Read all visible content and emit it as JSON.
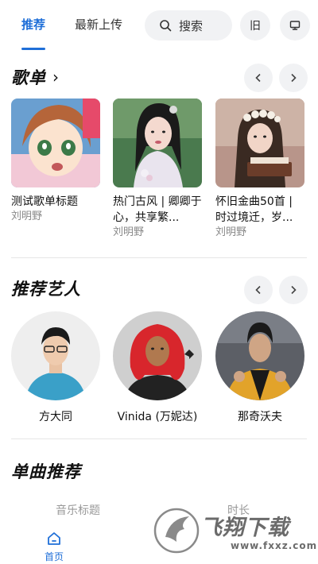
{
  "header": {
    "tabs": [
      {
        "label": "推荐",
        "active": true
      },
      {
        "label": "最新上传",
        "active": false
      }
    ],
    "search": {
      "label": "搜索",
      "icon": "search-icon"
    },
    "old_button_label": "旧",
    "desktop_icon": "monitor-icon",
    "accent_color": "#1f6fd8"
  },
  "playlists": {
    "title": "歌单",
    "title_chevron": "›",
    "items": [
      {
        "title": "测试歌单标题",
        "author": "刘明野"
      },
      {
        "title": "热门古风 | 卿卿于心，共享繁...",
        "author": "刘明野"
      },
      {
        "title": "怀旧金曲50首 | 时过境迁，岁...",
        "author": "刘明野"
      }
    ]
  },
  "artists": {
    "title": "推荐艺人",
    "items": [
      {
        "name": "方大同"
      },
      {
        "name": "Vinida (万妮达)"
      },
      {
        "name": "那奇沃夫"
      }
    ]
  },
  "songs": {
    "title": "单曲推荐",
    "columns": [
      "音乐标题",
      "时长"
    ]
  },
  "bottom_nav": {
    "home_label": "首页",
    "home_icon": "home-icon"
  },
  "watermark": {
    "text": "飞翔下载",
    "url": "www.fxxz.com"
  }
}
